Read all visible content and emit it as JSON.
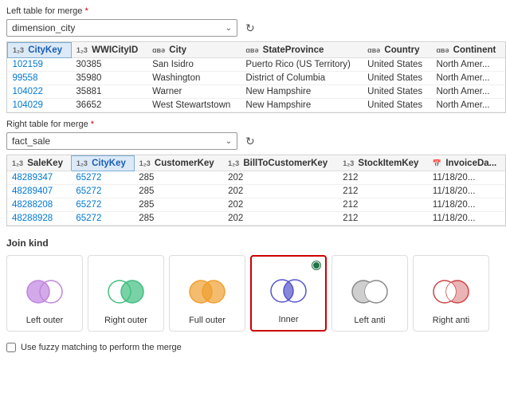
{
  "left_table": {
    "label": "Left table for merge",
    "required": true,
    "selected": "dimension_city",
    "columns": [
      {
        "icon": "123",
        "name": "CityKey",
        "highlighted": true
      },
      {
        "icon": "123",
        "name": "WWICityID"
      },
      {
        "icon": "abc",
        "name": "City"
      },
      {
        "icon": "abc",
        "name": "StateProvince"
      },
      {
        "icon": "abc",
        "name": "Country"
      },
      {
        "icon": "abc",
        "name": "Continent"
      }
    ],
    "rows": [
      [
        "102159",
        "30385",
        "San Isidro",
        "Puerto Rico (US Territory)",
        "United States",
        "North Amer..."
      ],
      [
        "99558",
        "35980",
        "Washington",
        "District of Columbia",
        "United States",
        "North Amer..."
      ],
      [
        "104022",
        "35881",
        "Warner",
        "New Hampshire",
        "United States",
        "North Amer..."
      ],
      [
        "104029",
        "36652",
        "West Stewartstown",
        "New Hampshire",
        "United States",
        "North Amer..."
      ]
    ]
  },
  "right_table": {
    "label": "Right table for merge",
    "required": true,
    "selected": "fact_sale",
    "columns": [
      {
        "icon": "123",
        "name": "SaleKey"
      },
      {
        "icon": "123",
        "name": "CityKey",
        "highlighted": true
      },
      {
        "icon": "123",
        "name": "CustomerKey"
      },
      {
        "icon": "123",
        "name": "BillToCustomerKey"
      },
      {
        "icon": "123",
        "name": "StockItemKey"
      },
      {
        "icon": "cal",
        "name": "InvoiceDa..."
      }
    ],
    "rows": [
      [
        "48289347",
        "65272",
        "285",
        "202",
        "212",
        "11/18/20..."
      ],
      [
        "48289407",
        "65272",
        "285",
        "202",
        "212",
        "11/18/20..."
      ],
      [
        "48288208",
        "65272",
        "285",
        "202",
        "212",
        "11/18/20..."
      ],
      [
        "48288928",
        "65272",
        "285",
        "202",
        "212",
        "11/18/20..."
      ]
    ]
  },
  "join_kind": {
    "label": "Join kind",
    "options": [
      {
        "id": "left-outer",
        "label": "Left outer",
        "selected": false
      },
      {
        "id": "right-outer",
        "label": "Right outer",
        "selected": false
      },
      {
        "id": "full-outer",
        "label": "Full outer",
        "selected": false
      },
      {
        "id": "inner",
        "label": "Inner",
        "selected": true
      },
      {
        "id": "left-anti",
        "label": "Left anti",
        "selected": false
      },
      {
        "id": "right-anti",
        "label": "Right anti",
        "selected": false
      }
    ]
  },
  "fuzzy": {
    "label": "Use fuzzy matching to perform the merge"
  },
  "scrollbar": {
    "vertical_visible": true
  }
}
